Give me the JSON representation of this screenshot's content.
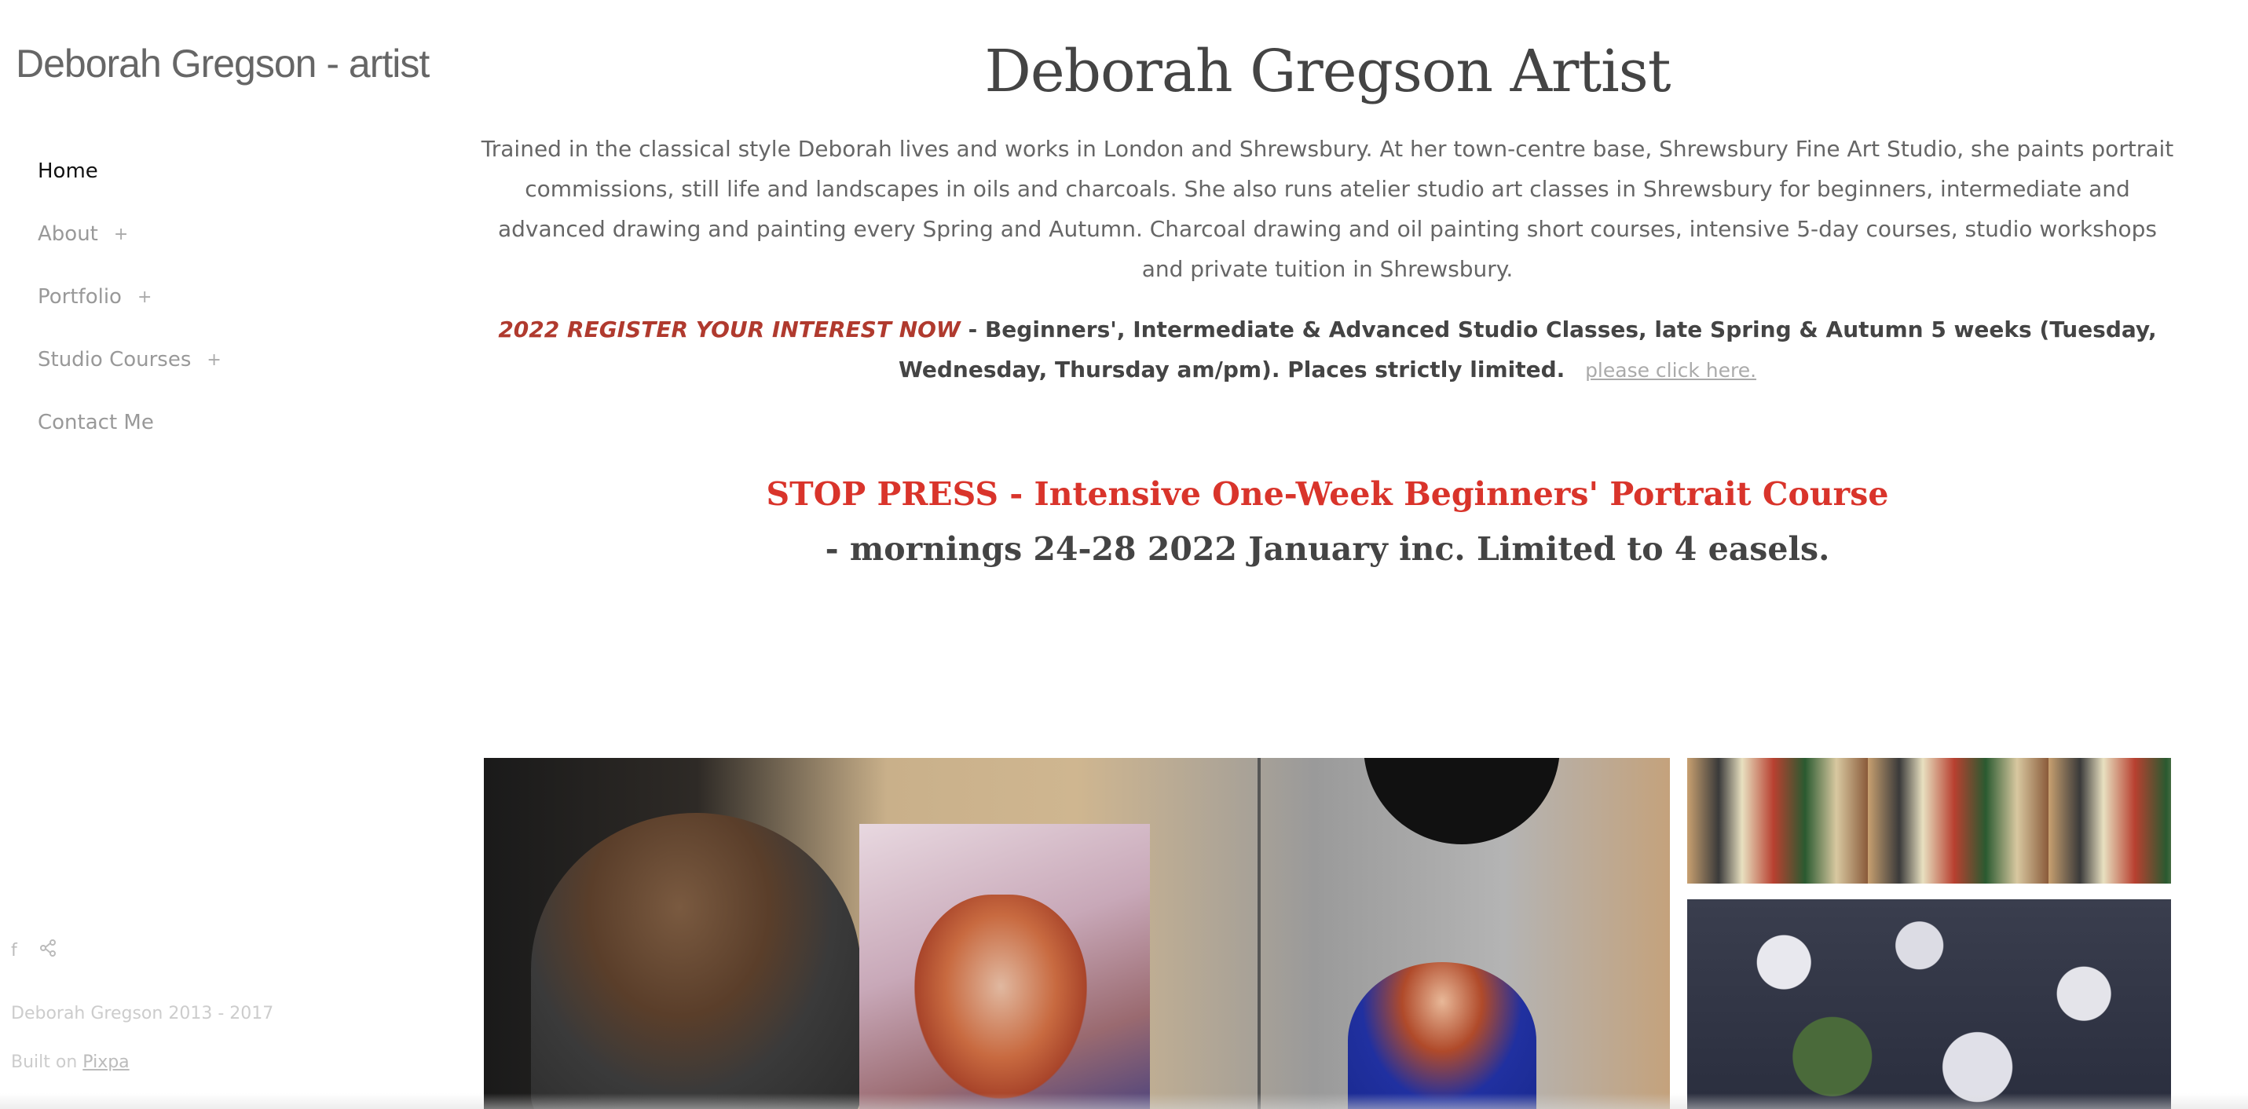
{
  "sidebar": {
    "site_title": "Deborah Gregson - artist",
    "nav": [
      {
        "label": "Home",
        "active": true,
        "expandable": false
      },
      {
        "label": "About",
        "active": false,
        "expandable": true
      },
      {
        "label": "Portfolio",
        "active": false,
        "expandable": true
      },
      {
        "label": "Studio Courses",
        "active": false,
        "expandable": true
      },
      {
        "label": "Contact Me",
        "active": false,
        "expandable": false
      }
    ],
    "expand_symbol": "+",
    "social": {
      "facebook_icon": "f",
      "share_icon": "⋖"
    },
    "copyright": "Deborah Gregson 2013 - 2017",
    "built_on_prefix": "Built on",
    "built_on_link": "Pixpa"
  },
  "main": {
    "heading": "Deborah Gregson Artist",
    "intro": "Trained in the classical style Deborah lives and works in London and Shrewsbury.  At her town-centre base, Shrewsbury Fine Art Studio, she paints portrait commissions, still life and landscapes in oils and charcoals.  She also runs atelier studio art classes in Shrewsbury for beginners, intermediate and advanced drawing and painting every Spring and Autumn. Charcoal drawing and oil painting short courses, intensive 5-day courses, studio workshops and private tuition in Shrewsbury.",
    "register_highlight": "2022 REGISTER YOUR INTEREST NOW",
    "register_text": " - Beginners', Intermediate & Advanced Studio Classes, late Spring & Autumn 5 weeks (Tuesday, Wednesday, Thursday am/pm). Places strictly limited.",
    "register_link": "please click here.",
    "stop_press": "STOP PRESS - Intensive One-Week Beginners' Portrait Course",
    "mornings": "- mornings 24-28 2022 January inc.  Limited to 4 easels."
  },
  "colors": {
    "accent_red": "#d9342b",
    "register_red": "#b03a2e",
    "text": "#666666"
  }
}
